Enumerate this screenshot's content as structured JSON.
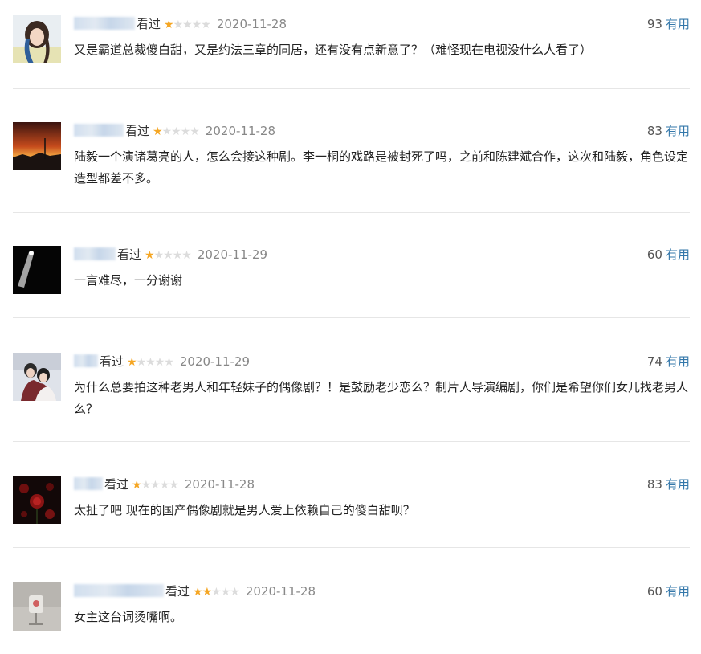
{
  "comments": [
    {
      "status": "看过",
      "rating": 1,
      "date": "2020-11-28",
      "votes": "93",
      "useful_label": "有用",
      "text": "又是霸道总裁傻白甜，又是约法三章的同居，还有没有点新意了？（难怪现在电视没什么人看了）",
      "avatar": "woman-portrait"
    },
    {
      "status": "看过",
      "rating": 1,
      "date": "2020-11-28",
      "votes": "83",
      "useful_label": "有用",
      "text": "陆毅一个演诸葛亮的人，怎么会接这种剧。李一桐的戏路是被封死了吗，之前和陈建斌合作，这次和陆毅，角色设定造型都差不多。",
      "avatar": "sunset"
    },
    {
      "status": "看过",
      "rating": 1,
      "date": "2020-11-29",
      "votes": "60",
      "useful_label": "有用",
      "text": "一言难尽，一分谢谢",
      "avatar": "spotlight"
    },
    {
      "status": "看过",
      "rating": 1,
      "date": "2020-11-29",
      "votes": "74",
      "useful_label": "有用",
      "text": "为什么总要拍这种老男人和年轻妹子的偶像剧？！是鼓励老少恋么？制片人导演编剧，你们是希望你们女儿找老男人么？",
      "avatar": "couple"
    },
    {
      "status": "看过",
      "rating": 1,
      "date": "2020-11-28",
      "votes": "83",
      "useful_label": "有用",
      "text": "太扯了吧 现在的国产偶像剧就是男人爱上依赖自己的傻白甜呗？",
      "avatar": "roses"
    },
    {
      "status": "看过",
      "rating": 2,
      "date": "2020-11-28",
      "votes": "60",
      "useful_label": "有用",
      "text": "女主这台词烫嘴啊。",
      "avatar": "cup"
    }
  ],
  "colors": {
    "star_on": "#f5a623",
    "star_off": "#dcdcdc",
    "link": "#3377aa",
    "date": "#888888"
  }
}
